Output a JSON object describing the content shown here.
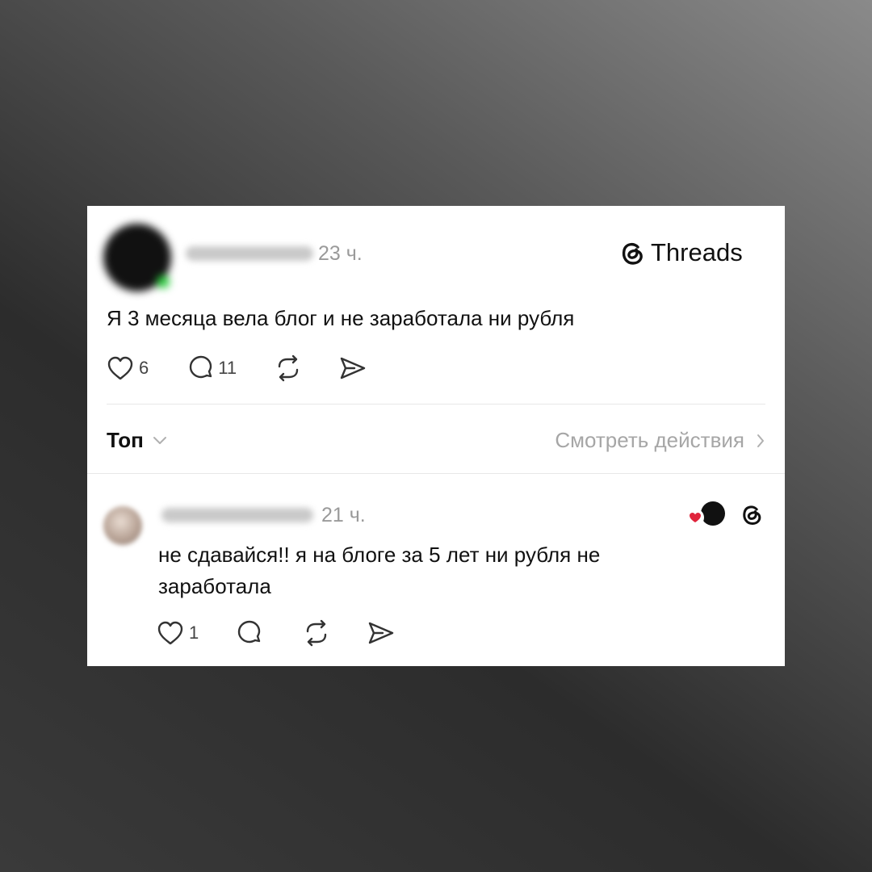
{
  "post": {
    "username_blurred": true,
    "time": "23 ч.",
    "text": "Я 3 месяца вела блог и не заработала ни рубля",
    "likes": "6",
    "comments": "11"
  },
  "brand": {
    "name": "Threads"
  },
  "sort": {
    "label": "Топ"
  },
  "view_activity": {
    "label": "Смотреть действия"
  },
  "reply": {
    "username_blurred": true,
    "time": "21 ч.",
    "text": "не сдавайся!! я на блоге за 5 лет ни рубля не заработала",
    "likes": "1"
  },
  "icons": [
    "heart-icon",
    "comment-icon",
    "repost-icon",
    "share-icon",
    "threads-logo-icon",
    "chevron-down-icon",
    "chevron-right-icon"
  ],
  "colors": {
    "background": "#ffffff",
    "muted": "#9a9a9a",
    "heart": "#e0243c",
    "online": "#2ecc40"
  }
}
